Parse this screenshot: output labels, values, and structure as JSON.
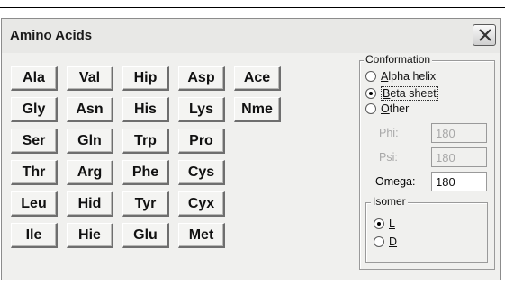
{
  "window": {
    "title": "Amino Acids"
  },
  "amino_acid_buttons": [
    [
      "Ala",
      "Val",
      "Hip",
      "Asp",
      "Ace"
    ],
    [
      "Gly",
      "Asn",
      "His",
      "Lys",
      "Nme"
    ],
    [
      "Ser",
      "Gln",
      "Trp",
      "Pro"
    ],
    [
      "Thr",
      "Arg",
      "Phe",
      "Cys"
    ],
    [
      "Leu",
      "Hid",
      "Tyr",
      "Cyx"
    ],
    [
      "Ile",
      "Hie",
      "Glu",
      "Met"
    ]
  ],
  "conformation": {
    "legend": "Conformation",
    "selected": "beta_sheet",
    "options": [
      {
        "id": "alpha_helix",
        "label": "Alpha helix",
        "mnemonic": "A",
        "rest": "lpha helix"
      },
      {
        "id": "beta_sheet",
        "label": "Beta sheet",
        "mnemonic": "B",
        "rest": "eta sheet"
      },
      {
        "id": "other",
        "label": "Other",
        "mnemonic": "O",
        "rest": "ther"
      }
    ]
  },
  "angles": {
    "phi": {
      "label": "Phi:",
      "value": "180",
      "enabled": false
    },
    "psi": {
      "label": "Psi:",
      "value": "180",
      "enabled": false
    },
    "omega": {
      "label": "Omega:",
      "value": "180",
      "enabled": true
    }
  },
  "isomer": {
    "legend": "Isomer",
    "selected": "L",
    "options": [
      {
        "id": "L",
        "label": "L"
      },
      {
        "id": "D",
        "label": "D"
      }
    ]
  }
}
